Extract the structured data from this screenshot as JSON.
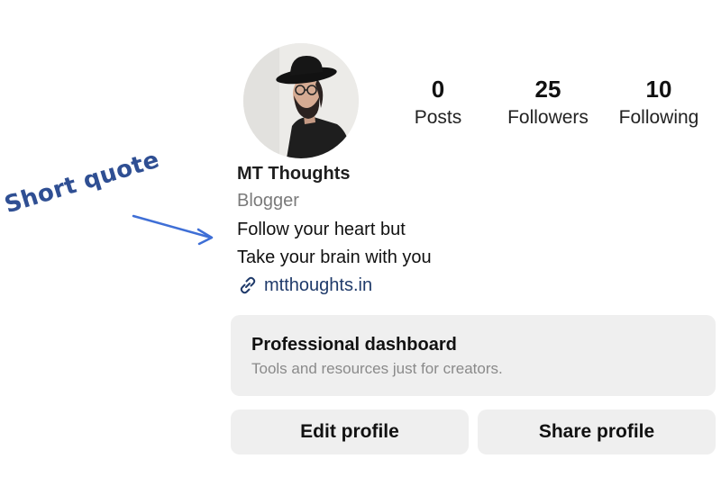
{
  "annotation": {
    "label": "Short quote"
  },
  "profile": {
    "name": "MT Thoughts",
    "category": "Blogger",
    "bio_lines": [
      "Follow your heart but",
      "Take your brain with you"
    ],
    "link": "mtthoughts.in",
    "avatar_icon": "profile-photo"
  },
  "stats": [
    {
      "value": "0",
      "label": "Posts"
    },
    {
      "value": "25",
      "label": "Followers"
    },
    {
      "value": "10",
      "label": "Following"
    }
  ],
  "dashboard": {
    "title": "Professional dashboard",
    "subtitle": "Tools and resources just for creators."
  },
  "buttons": {
    "edit": "Edit profile",
    "share": "Share profile"
  },
  "colors": {
    "annotation": "#2f4f93",
    "arrow": "#3f6fd6",
    "link": "#1f3a6a",
    "card_bg": "#efefef",
    "secondary_text": "#7a7a7a"
  }
}
